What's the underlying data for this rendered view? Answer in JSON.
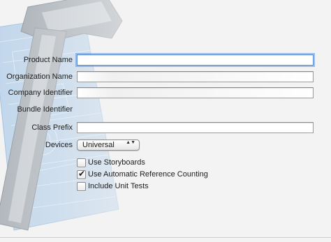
{
  "form": {
    "product_name": {
      "label": "Product Name",
      "value": ""
    },
    "organization_name": {
      "label": "Organization Name",
      "value": ""
    },
    "company_identifier": {
      "label": "Company Identifier",
      "value": ""
    },
    "bundle_identifier": {
      "label": "Bundle Identifier",
      "value": ""
    },
    "class_prefix": {
      "label": "Class Prefix",
      "value": ""
    },
    "devices": {
      "label": "Devices",
      "selected": "Universal",
      "arrows": "▲▼"
    },
    "options": [
      {
        "label": "Use Storyboards",
        "checked": false
      },
      {
        "label": "Use Automatic Reference Counting",
        "checked": true
      },
      {
        "label": "Include Unit Tests",
        "checked": false
      }
    ],
    "check_mark": "✔"
  }
}
